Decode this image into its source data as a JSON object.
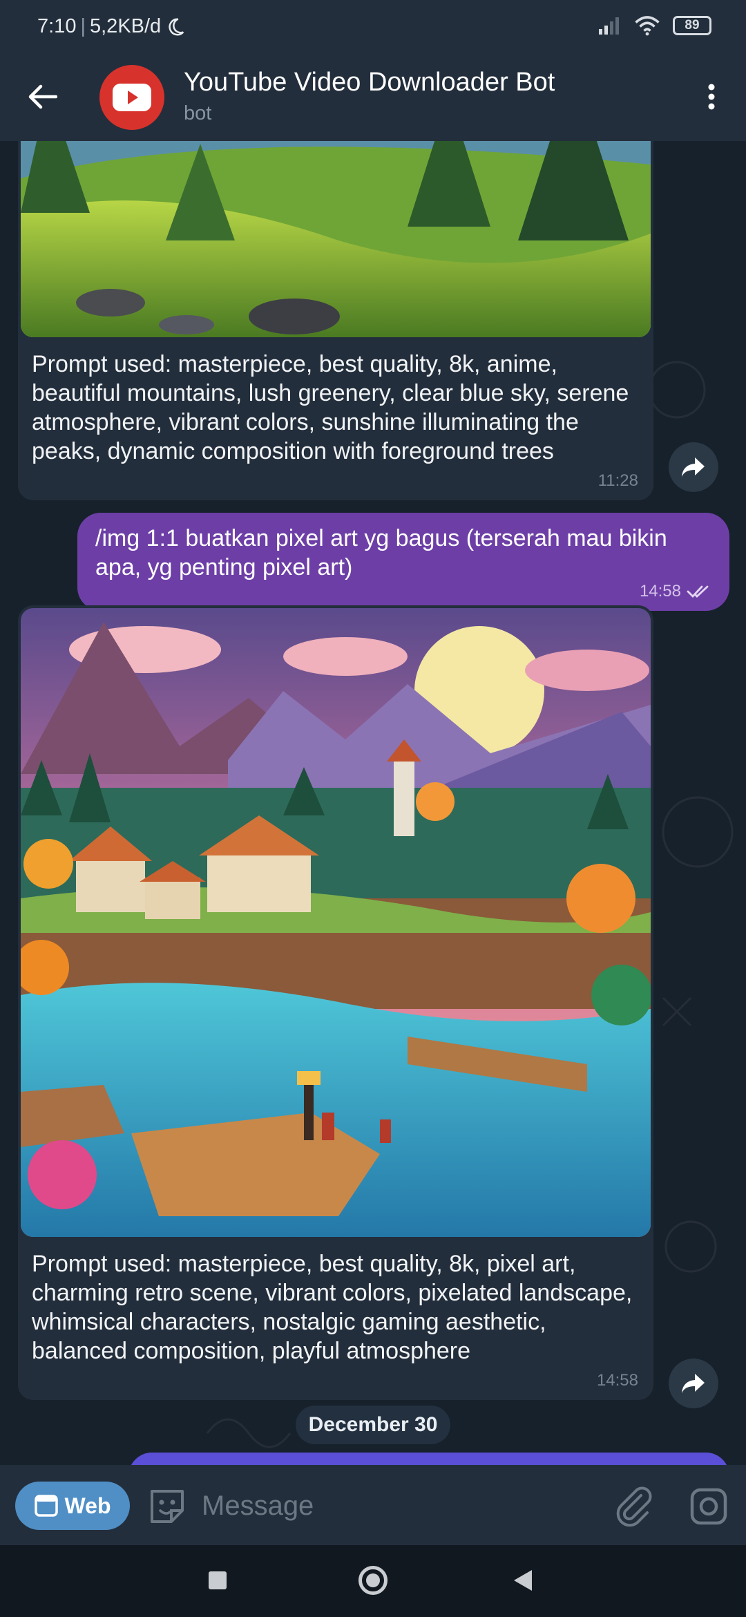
{
  "status_bar": {
    "time": "7:10",
    "speed": "5,2KB/d",
    "battery": "89"
  },
  "header": {
    "title": "YouTube Video Downloader Bot",
    "subtitle": "bot"
  },
  "messages": [
    {
      "type": "incoming-photo",
      "caption": "Prompt used: masterpiece, best quality, 8k, anime, beautiful mountains, lush greenery, clear blue sky, serene atmosphere, vibrant colors, sunshine illuminating the peaks, dynamic composition with foreground trees",
      "time": "11:28"
    },
    {
      "type": "outgoing",
      "text": "/img 1:1 buatkan pixel art yg bagus (terserah mau bikin apa, yg penting pixel art)",
      "time": "14:58"
    },
    {
      "type": "incoming-photo",
      "caption": "Prompt used: masterpiece, best quality, 8k, pixel art, charming retro scene, vibrant colors, pixelated landscape, whimsical characters, nostalgic gaming aesthetic, balanced composition, playful atmosphere",
      "time": "14:58"
    }
  ],
  "date_separator": "December 30",
  "input_bar": {
    "web_label": "Web",
    "placeholder": "Message"
  },
  "colors": {
    "header_bg": "#232e3c",
    "chat_bg": "#17212b",
    "outgoing_bubble": "#6d3fa6",
    "incoming_bubble": "#232e3c",
    "web_button": "#4f8fc6",
    "avatar": "#d7332c"
  },
  "icons": [
    "back-arrow-icon",
    "youtube-play-icon",
    "more-vert-icon",
    "share-icon",
    "double-check-icon",
    "web-window-icon",
    "sticker-icon",
    "paperclip-icon",
    "camera-icon"
  ]
}
